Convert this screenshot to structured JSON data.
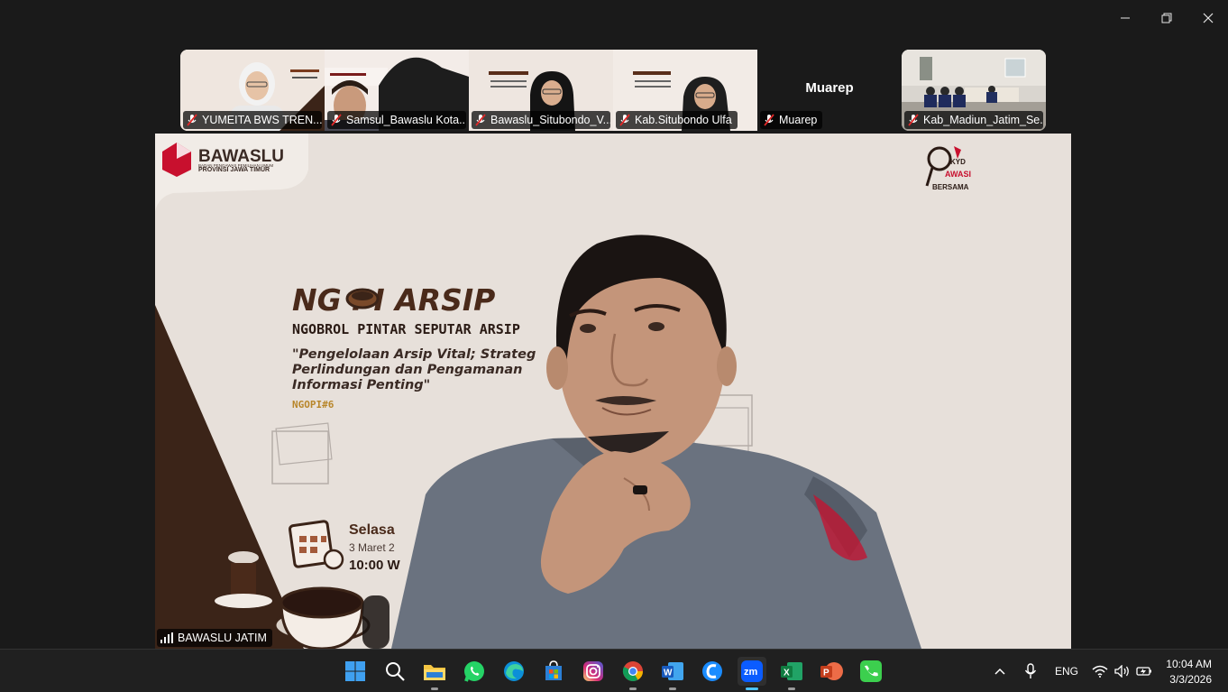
{
  "window": {
    "minimize": "—",
    "maximize": "❐",
    "close": "✕"
  },
  "participants": [
    {
      "name": "YUMEITA BWS TREN..."
    },
    {
      "name": "Samsul_Bawaslu Kota..."
    },
    {
      "name": "Bawaslu_Situbondo_V..."
    },
    {
      "name": "Kab.Situbondo Ulfa"
    },
    {
      "name": "Muarep",
      "center_name": "Muarep"
    },
    {
      "name": "Kab_Madiun_Jatim_Se..."
    }
  ],
  "main": {
    "speaker": "BAWASLU JATIM",
    "logo_text": "BAWASLU",
    "logo_sub1": "BADAN PENGAWAS PEMILIHAN UMUM",
    "logo_sub2": "PROVINSI JAWA TIMUR",
    "event_title": "NG  PI ARSIP",
    "event_subtitle": "NGOBROL PINTAR SEPUTAR ARSIP",
    "quote_line1": "\"Pengelolaan Arsip Vital; Strateg",
    "quote_line2": "Perlindungan dan Pengamanan",
    "quote_line3": "Informasi Penting\"",
    "edition": "NGOPI#6",
    "day": "Selasa",
    "date": "3 Maret 2",
    "time": "10:00 W",
    "badge_line1": "KYD",
    "badge_line2": "AWASI",
    "badge_line3": "BERSAMA"
  },
  "tray": {
    "language": "ENG",
    "time": "10:04 AM",
    "date": "3/3/2026",
    "chevron": "^"
  },
  "colors": {
    "background": "#1a1a1a",
    "taskbar": "#202020",
    "accent": "#4cc2ff",
    "bawaslu_red": "#c8102e",
    "coffee_brown": "#3b2418"
  }
}
